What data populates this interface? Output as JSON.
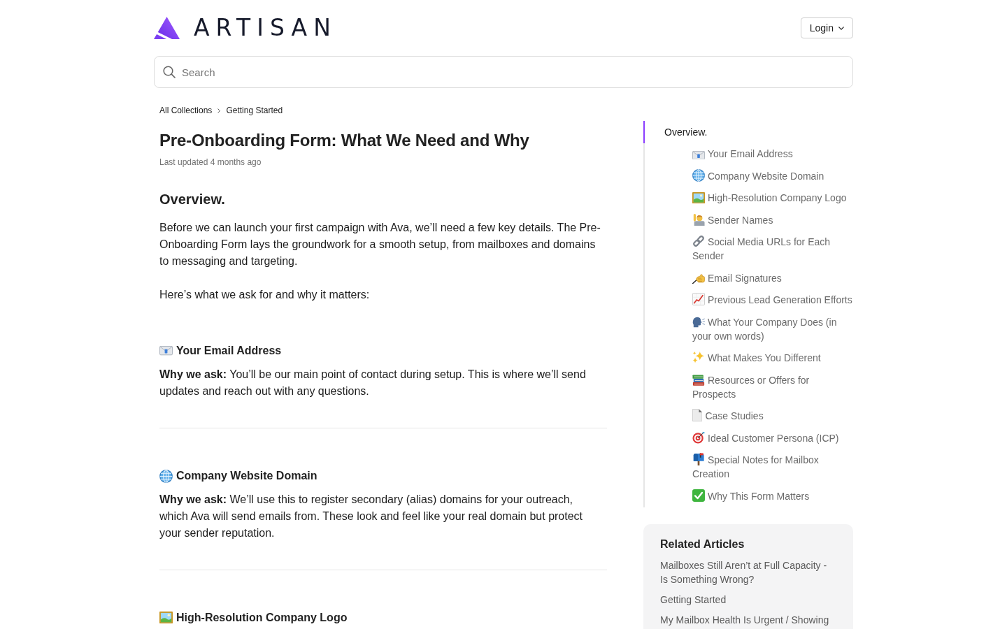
{
  "header": {
    "brand": "ARTISAN",
    "login": "Login"
  },
  "search": {
    "placeholder": "Search"
  },
  "breadcrumbs": [
    {
      "label": "All Collections"
    },
    {
      "label": "Getting Started"
    }
  ],
  "article": {
    "title": "Pre-Onboarding Form: What We Need and Why",
    "updated": "Last updated 4 months ago",
    "overview": {
      "heading": "Overview.",
      "paragraphs": [
        "Before we can launch your first campaign with Ava, we’ll need a few key details. The Pre-Onboarding Form lays the groundwork for a smooth setup, from mailboxes and domains to messaging and targeting.",
        "Here’s what we ask for and why it matters:"
      ]
    },
    "sections": [
      {
        "kind": "email",
        "heading": "Your Email Address",
        "body": "**Why we ask:** You’ll be our main point of contact during setup. This is where we’ll send updates and reach out with any questions."
      },
      {
        "kind": "website",
        "heading": "Company Website Domain",
        "body": "**Why we ask:** We’ll use this to register secondary (alias) domains for your outreach, which Ava will send emails from. These look and feel like your real domain but protect your sender reputation."
      },
      {
        "kind": "logo",
        "heading": "High-Resolution Company Logo"
      }
    ]
  },
  "toc": [
    {
      "label": "Overview.",
      "selected": true,
      "children": [
        {
          "kind": "email",
          "label": "Your Email Address",
          "selected": false
        },
        {
          "kind": "website",
          "label": "Company Website Domain",
          "selected": false
        },
        {
          "kind": "logo",
          "label": "High-Resolution Company Logo",
          "selected": false
        },
        {
          "kind": "senders",
          "label": "Sender Names",
          "selected": false
        },
        {
          "kind": "social",
          "label": "Social Media URLs for Each Sender",
          "selected": false
        },
        {
          "kind": "signature",
          "label": "Email Signatures",
          "selected": false
        },
        {
          "kind": "history",
          "label": "Previous Lead Generation Efforts",
          "selected": false
        },
        {
          "kind": "pitch",
          "label": "What Your Company Does (in your own words)",
          "selected": false
        },
        {
          "kind": "difference",
          "label": "What Makes You Different",
          "selected": false
        },
        {
          "kind": "resources",
          "label": "Resources or Offers for Prospects",
          "selected": false
        },
        {
          "kind": "cases",
          "label": "Case Studies",
          "selected": false
        },
        {
          "kind": "persona",
          "label": "Ideal Customer Persona (ICP)",
          "selected": false
        },
        {
          "kind": "mailbox",
          "label": "Special Notes for Mailbox Creation",
          "selected": false
        },
        {
          "kind": "summary",
          "label": "Why This Form Matters",
          "selected": false
        }
      ]
    }
  ],
  "related_articles": {
    "title": "Related Articles",
    "links": [
      "Mailboxes Still Aren’t at Full Capacity - Is Something Wrong?",
      "Getting Started",
      "My Mailbox Health Is Urgent / Showing"
    ]
  }
}
